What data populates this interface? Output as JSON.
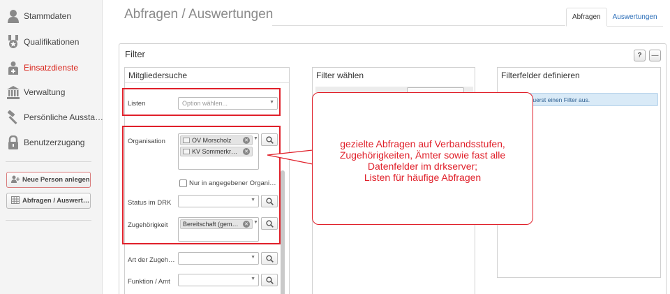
{
  "sidebar": {
    "items": [
      {
        "label": "Stammdaten",
        "icon": "person-icon"
      },
      {
        "label": "Qualifikationen",
        "icon": "medal-icon"
      },
      {
        "label": "Einsatzdienste",
        "icon": "responder-icon"
      },
      {
        "label": "Verwaltung",
        "icon": "building-icon"
      },
      {
        "label": "Persönliche Aussta…",
        "icon": "hammer-icon"
      },
      {
        "label": "Benutzerzugang",
        "icon": "lock-icon"
      }
    ],
    "active_item": "Einsatzdienste",
    "buttons": {
      "new_person": "Neue Person anlegen",
      "queries": "Abfragen / Auswert…"
    }
  },
  "header": {
    "title": "Abfragen / Auswertungen",
    "tabs": [
      {
        "label": "Abfragen",
        "active": true
      },
      {
        "label": "Auswertungen",
        "active": false
      }
    ]
  },
  "filter_panel": {
    "title": "Filter",
    "help_label": "?",
    "collapse_label": "—",
    "member_search": {
      "title": "Mitgliedersuche",
      "lists_label": "Listen",
      "lists_placeholder": "Option wählen...",
      "organisation_label": "Organisation",
      "organisation_chips": [
        "OV Morscholz",
        "KV Sommerkr…"
      ],
      "only_given_org_label": "Nur in angegebener Organi…",
      "status_label": "Status im DRK",
      "membership_label": "Zugehörigkeit",
      "membership_chips": [
        "Bereitschaft (gem…"
      ],
      "membership_type_label": "Art der Zugeh…",
      "function_label": "Funktion / Amt"
    },
    "choose_filter": {
      "title": "Filter wählen"
    },
    "define_fields": {
      "title": "Filterfelder definieren",
      "info": "e zuerst einen Filter aus."
    }
  },
  "callout": {
    "lines": [
      "gezielte Abfragen auf Verbandsstufen,",
      "Zugehörigkeiten, Ämter sowie fast alle",
      "Datenfelder im drkserver;",
      "Listen für häufige Abfragen"
    ]
  },
  "colors": {
    "accent_red": "#e0202a",
    "link_blue": "#2a6db8",
    "info_bg": "#d9eaf7"
  }
}
